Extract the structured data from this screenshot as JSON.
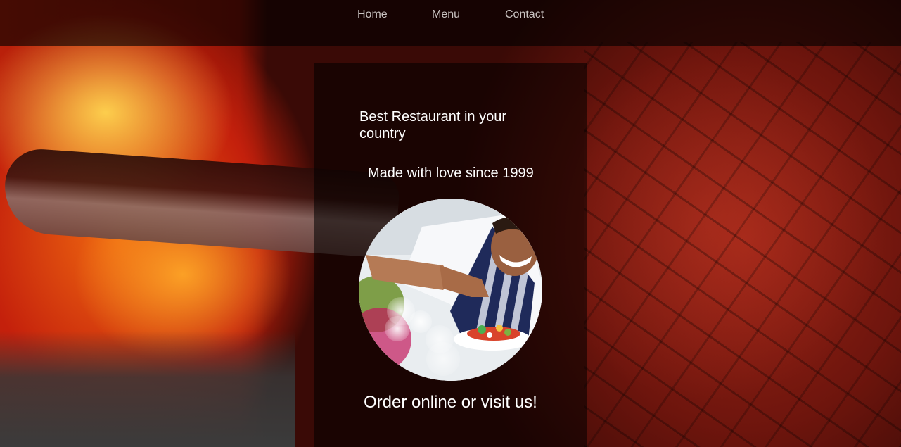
{
  "nav": {
    "home_label": "Home",
    "menu_label": "Menu",
    "contact_label": "Contact"
  },
  "hero": {
    "headline": "Best Restaurant in your country",
    "subline": "Made with love since 1999",
    "cta": "Order online or visit us!",
    "image_subject": "chef-plating-dish-photo"
  },
  "colors": {
    "nav_text": "#c9c3c1",
    "panel_text": "#ffffff",
    "overlay": "#000000"
  }
}
